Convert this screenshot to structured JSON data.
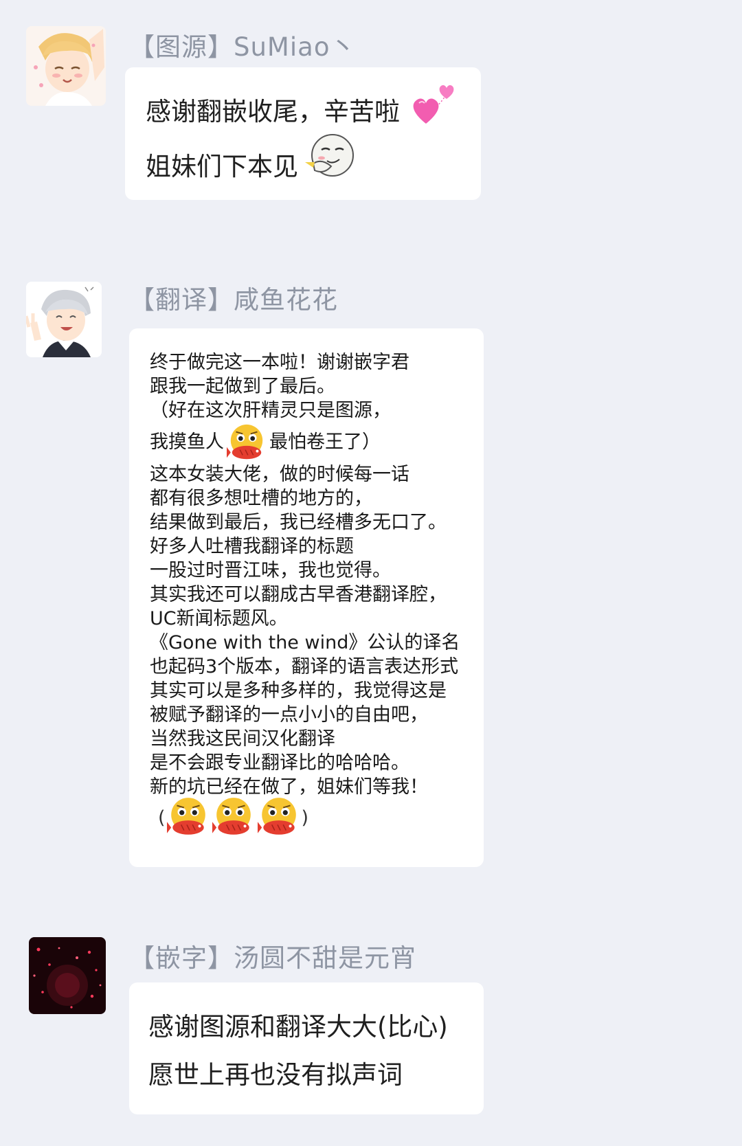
{
  "messages": [
    {
      "sender": "【图源】SuMiao丶",
      "lines": [
        "感谢翻嵌收尾，辛苦啦",
        "姐妹们下本见"
      ],
      "emojis": [
        "pink-hearts-icon",
        "smirking-face-icon"
      ]
    },
    {
      "sender": "【翻译】咸鱼花花",
      "lines": [
        "终于做完这一本啦！谢谢嵌字君",
        "跟我一起做到了最后。",
        "（好在这次肝精灵只是图源，",
        "我摸鱼人",
        "最怕卷王了）",
        "这本女装大佬，做的时候每一话",
        "都有很多想吐槽的地方的，",
        "结果做到最后，我已经槽多无口了。",
        "好多人吐槽我翻译的标题",
        "一股过时晋江味，我也觉得。",
        "其实我还可以翻成古早香港翻译腔，",
        "UC新闻标题风。",
        "《Gone with the wind》公认的译名",
        "也起码3个版本，翻译的语言表达形式",
        "其实可以是多种多样的，我觉得这是",
        "被赋予翻译的一点小小的自由吧，",
        "当然我这民间汉化翻译",
        "是不会跟专业翻译比的哈哈哈。",
        "新的坑已经在做了，姐妹们等我！"
      ],
      "emoji_row_open": "(",
      "emoji_row_close": ")",
      "emojis": [
        "fish-eating-face-icon"
      ]
    },
    {
      "sender": "【嵌字】汤圆不甜是元宵",
      "lines": [
        "感谢图源和翻译大大(比心)",
        "愿世上再也没有拟声词"
      ]
    }
  ],
  "colors": {
    "background": "#eef0f6",
    "bubble": "#ffffff",
    "sender_name": "#8e95a3",
    "text": "#1f1f1f",
    "heart": "#f25db0",
    "emoji_face": "#f7c531",
    "fish": "#e43d2f"
  }
}
